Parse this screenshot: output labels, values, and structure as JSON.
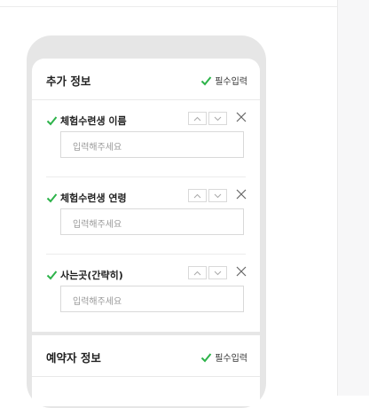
{
  "additional_info": {
    "title": "추가 정보",
    "required_label": "필수입력",
    "fields": [
      {
        "label": "체험수련생 이름",
        "placeholder": "입력해주세요"
      },
      {
        "label": "체험수련생 연령",
        "placeholder": "입력해주세요"
      },
      {
        "label": "사는곳(간략히)",
        "placeholder": "입력해주세요"
      }
    ]
  },
  "booker_info": {
    "title": "예약자 정보",
    "required_label": "필수입력"
  },
  "colors": {
    "check": "#2db34a",
    "border": "#d9d9d9",
    "placeholder": "#9a9a9a"
  },
  "icons": [
    "check-icon",
    "chevron-up-icon",
    "chevron-down-icon",
    "close-icon"
  ]
}
